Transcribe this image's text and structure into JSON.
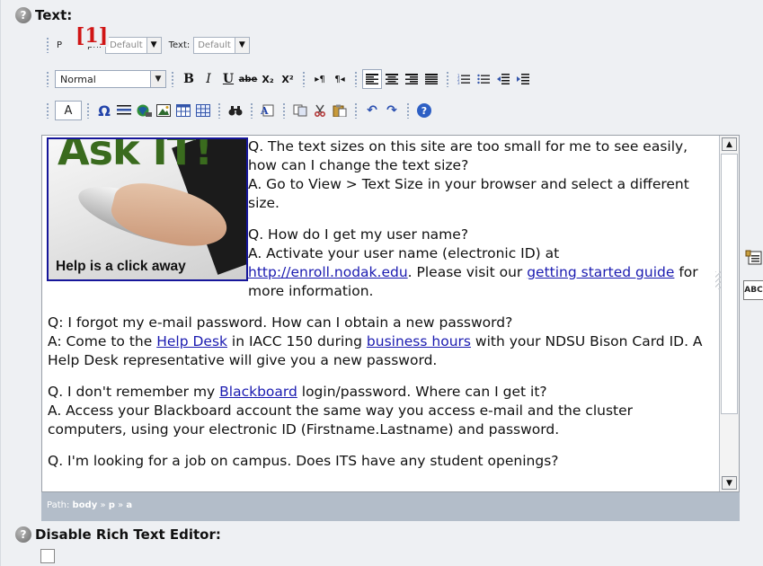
{
  "text_field": {
    "label": "Text:",
    "help_icon": "?"
  },
  "toolbar": {
    "paragraph_label_start": "P",
    "paragraph_label_end": "ph:",
    "paragraph_value": "Default",
    "text_label": "Text:",
    "text_value": "Default",
    "format_value": "Normal",
    "bold": "B",
    "italic": "I",
    "underline": "U",
    "strike": "abe",
    "subscript": "X₂",
    "superscript": "X²",
    "ltr": "▸¶",
    "rtl": "¶◂",
    "font_button": "A",
    "omega": "Ω",
    "find": "🔍",
    "undo": "↶",
    "redo": "↷",
    "help": "?"
  },
  "annotation_marker": "[1]",
  "editor": {
    "image_title": "Ask IT!",
    "image_tagline": "Help is a click away",
    "p1_q": "Q. The text sizes on this site are too small for me to see easily, how can I change the text size?",
    "p1_a": "A. Go to View > Text Size in your browser and select a different size.",
    "p2_q": "Q. How do I get my user name?",
    "p2_a1": "A. Activate your user name (electronic ID) at ",
    "p2_link1": "http://enroll.nodak.edu",
    "p2_a2": ". Please visit our ",
    "p2_link2": "getting started guide",
    "p2_a3": " for more information.",
    "p3_q": "Q: I forgot my e-mail password. How can I obtain a new password?",
    "p3_a1": "A: Come to the ",
    "p3_link1": "Help Desk",
    "p3_a2": " in IACC 150 during ",
    "p3_link2": "business hours",
    "p3_a3": " with your NDSU Bison Card ID.  A Help Desk representative will give you a new password.",
    "p4_q1": "Q. I don't remember my ",
    "p4_link": "Blackboard",
    "p4_q2": " login/password. Where can I get it?",
    "p4_a": "A. Access your Blackboard account the same way you access e-mail and the cluster computers, using your electronic ID (Firstname.Lastname) and password.",
    "p5_q": "Q. I'm looking for a job on campus. Does ITS have any student openings?"
  },
  "path_bar": {
    "label": "Path:",
    "body": "body",
    "sep": "»",
    "p": "p",
    "a": "a"
  },
  "disable_editor": {
    "label": "Disable Rich Text Editor:"
  },
  "side_icons": {
    "icon2_text": "ABC"
  }
}
